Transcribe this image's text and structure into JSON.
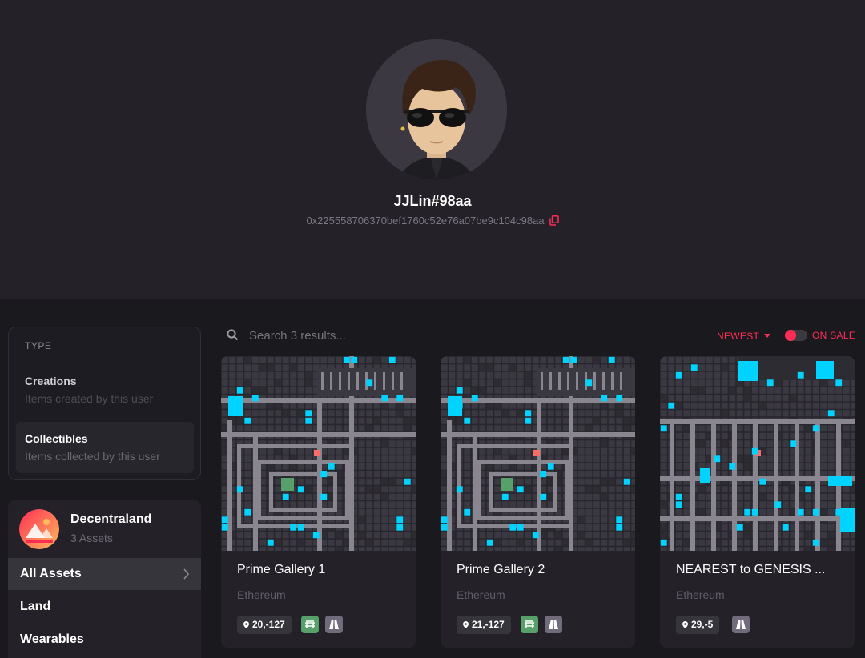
{
  "profile": {
    "username": "JJLin#98aa",
    "address": "0x225558706370bef1760c52e76a07be9c104c98aa"
  },
  "sidebar": {
    "type_title": "TYPE",
    "options": [
      {
        "title": "Creations",
        "subtitle": "Items created by this user",
        "selected": false
      },
      {
        "title": "Collectibles",
        "subtitle": "Items collected by this user",
        "selected": true
      }
    ],
    "world": {
      "name": "Decentraland",
      "count": "3 Assets"
    },
    "nav": [
      {
        "label": "All Assets",
        "selected": true
      },
      {
        "label": "Land",
        "selected": false
      },
      {
        "label": "Wearables",
        "selected": false
      }
    ]
  },
  "toolbar": {
    "search_placeholder": "Search 3 results...",
    "sort_label": "NEWEST",
    "on_sale_label": "ON SALE"
  },
  "cards": [
    {
      "title": "Prime Gallery 1",
      "network": "Ethereum",
      "coords": "20,-127",
      "badges": [
        "plaza",
        "road"
      ]
    },
    {
      "title": "Prime Gallery 2",
      "network": "Ethereum",
      "coords": "21,-127",
      "badges": [
        "plaza",
        "road"
      ]
    },
    {
      "title": "NEAREST to GENESIS ...",
      "network": "Ethereum",
      "coords": "29,-5",
      "badges": [
        "road"
      ]
    }
  ],
  "colors": {
    "accent": "#ff2d55",
    "plaza": "#57a06a",
    "road": "#716b7c",
    "owned": "#00d3ff"
  }
}
